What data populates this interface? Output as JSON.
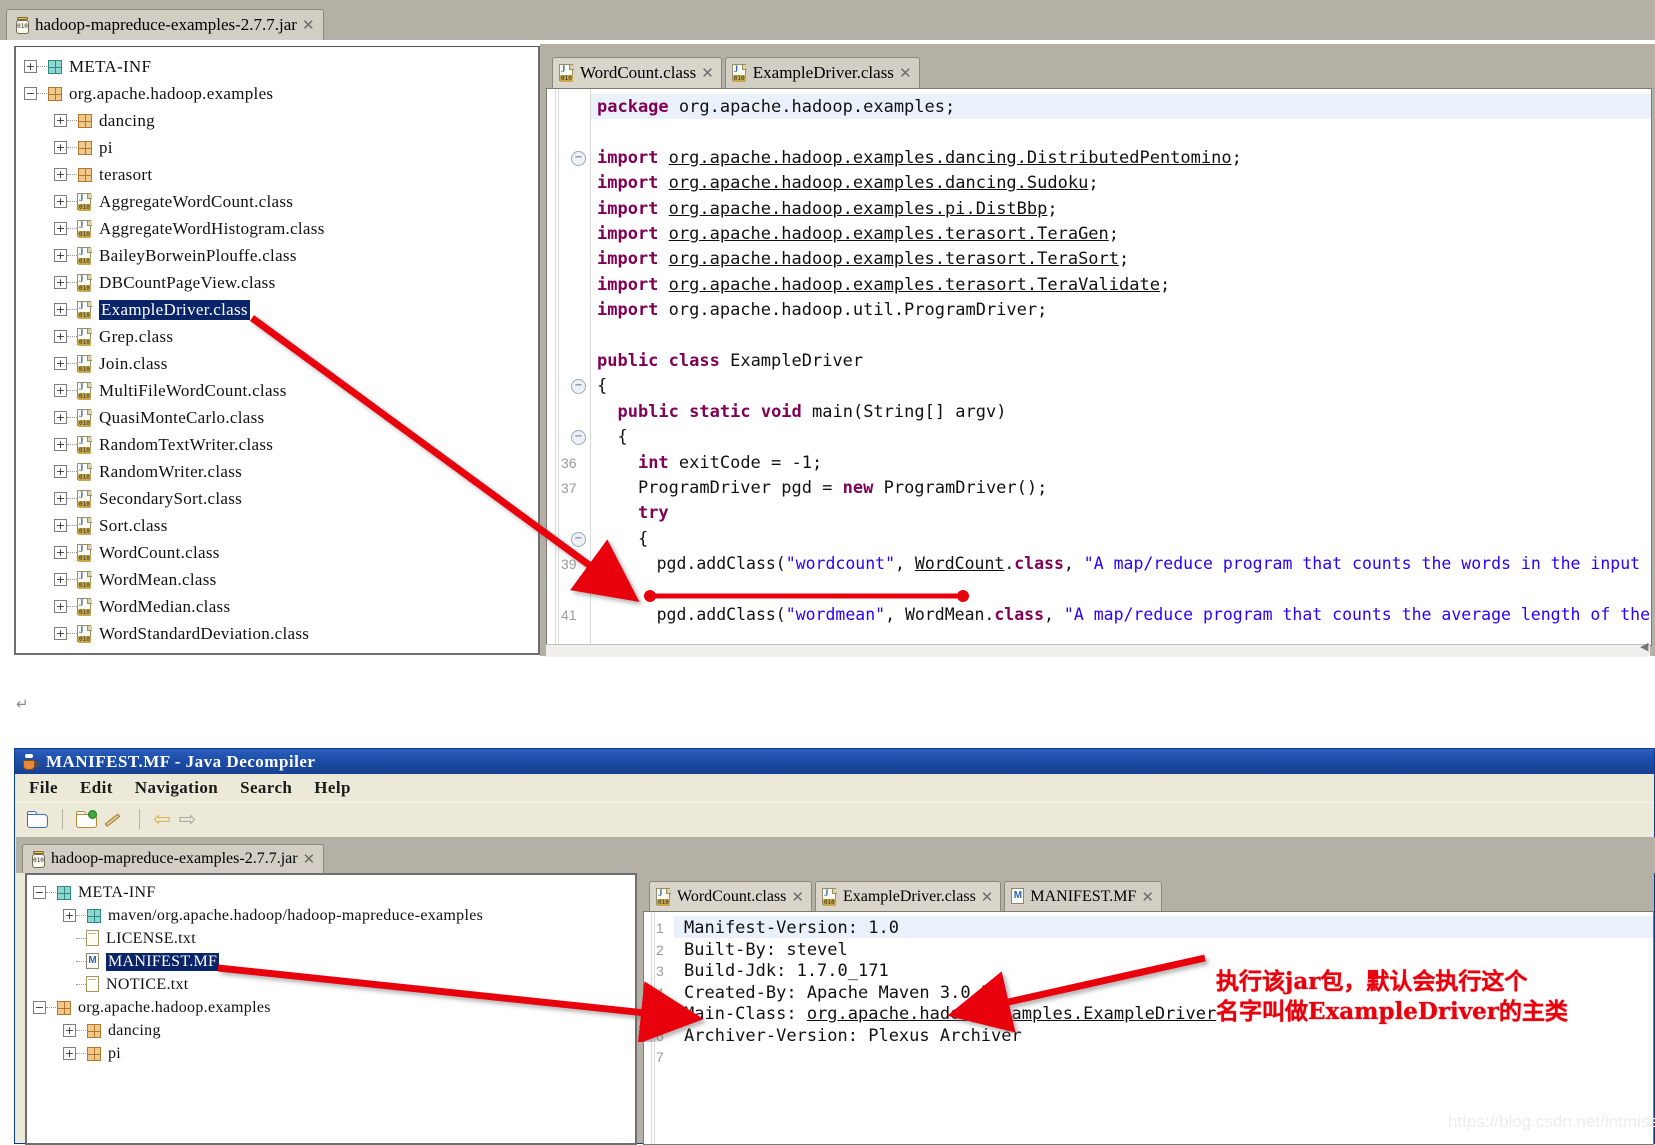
{
  "top_window": {
    "jar_tab": {
      "label": "hadoop-mapreduce-examples-2.7.7.jar",
      "close": "✕",
      "icon": "jar-icon"
    },
    "tree": [
      {
        "indent": 0,
        "toggle": "+",
        "icon": "package-icon-teal",
        "label": "META-INF",
        "selected": false
      },
      {
        "indent": 0,
        "toggle": "−",
        "icon": "package-icon",
        "label": "org.apache.hadoop.examples",
        "selected": false
      },
      {
        "indent": 1,
        "toggle": "+",
        "icon": "package-icon",
        "label": "dancing",
        "selected": false
      },
      {
        "indent": 1,
        "toggle": "+",
        "icon": "package-icon",
        "label": "pi",
        "selected": false
      },
      {
        "indent": 1,
        "toggle": "+",
        "icon": "package-icon",
        "label": "terasort",
        "selected": false
      },
      {
        "indent": 1,
        "toggle": "+",
        "icon": "class-icon",
        "label": "AggregateWordCount.class",
        "selected": false
      },
      {
        "indent": 1,
        "toggle": "+",
        "icon": "class-icon",
        "label": "AggregateWordHistogram.class",
        "selected": false
      },
      {
        "indent": 1,
        "toggle": "+",
        "icon": "class-icon",
        "label": "BaileyBorweinPlouffe.class",
        "selected": false
      },
      {
        "indent": 1,
        "toggle": "+",
        "icon": "class-icon",
        "label": "DBCountPageView.class",
        "selected": false
      },
      {
        "indent": 1,
        "toggle": "+",
        "icon": "class-icon",
        "label": "ExampleDriver.class",
        "selected": true
      },
      {
        "indent": 1,
        "toggle": "+",
        "icon": "class-icon",
        "label": "Grep.class",
        "selected": false
      },
      {
        "indent": 1,
        "toggle": "+",
        "icon": "class-icon",
        "label": "Join.class",
        "selected": false
      },
      {
        "indent": 1,
        "toggle": "+",
        "icon": "class-icon",
        "label": "MultiFileWordCount.class",
        "selected": false
      },
      {
        "indent": 1,
        "toggle": "+",
        "icon": "class-icon",
        "label": "QuasiMonteCarlo.class",
        "selected": false
      },
      {
        "indent": 1,
        "toggle": "+",
        "icon": "class-icon",
        "label": "RandomTextWriter.class",
        "selected": false
      },
      {
        "indent": 1,
        "toggle": "+",
        "icon": "class-icon",
        "label": "RandomWriter.class",
        "selected": false
      },
      {
        "indent": 1,
        "toggle": "+",
        "icon": "class-icon",
        "label": "SecondarySort.class",
        "selected": false
      },
      {
        "indent": 1,
        "toggle": "+",
        "icon": "class-icon",
        "label": "Sort.class",
        "selected": false
      },
      {
        "indent": 1,
        "toggle": "+",
        "icon": "class-icon",
        "label": "WordCount.class",
        "selected": false
      },
      {
        "indent": 1,
        "toggle": "+",
        "icon": "class-icon",
        "label": "WordMean.class",
        "selected": false
      },
      {
        "indent": 1,
        "toggle": "+",
        "icon": "class-icon",
        "label": "WordMedian.class",
        "selected": false
      },
      {
        "indent": 1,
        "toggle": "+",
        "icon": "class-icon",
        "label": "WordStandardDeviation.class",
        "selected": false
      }
    ],
    "editor_tabs": [
      {
        "label": "WordCount.class",
        "icon": "class-icon",
        "close": "✕",
        "active": false
      },
      {
        "label": "ExampleDriver.class",
        "icon": "class-icon",
        "close": "✕",
        "active": true
      }
    ],
    "code_lines": [
      {
        "num": "",
        "fold": "",
        "text": "package org.apache.hadoop.examples;",
        "highlight": true
      },
      {
        "num": "",
        "fold": "",
        "text": ""
      },
      {
        "num": "",
        "fold": "−",
        "text": "import org.apache.hadoop.examples.dancing.DistributedPentomino;"
      },
      {
        "num": "",
        "fold": "",
        "text": "import org.apache.hadoop.examples.dancing.Sudoku;"
      },
      {
        "num": "",
        "fold": "",
        "text": "import org.apache.hadoop.examples.pi.DistBbp;"
      },
      {
        "num": "",
        "fold": "",
        "text": "import org.apache.hadoop.examples.terasort.TeraGen;"
      },
      {
        "num": "",
        "fold": "",
        "text": "import org.apache.hadoop.examples.terasort.TeraSort;"
      },
      {
        "num": "",
        "fold": "",
        "text": "import org.apache.hadoop.examples.terasort.TeraValidate;"
      },
      {
        "num": "",
        "fold": "",
        "text": "import org.apache.hadoop.util.ProgramDriver;"
      },
      {
        "num": "",
        "fold": "",
        "text": ""
      },
      {
        "num": "",
        "fold": "",
        "text": "public class ExampleDriver"
      },
      {
        "num": "",
        "fold": "−",
        "text": "{"
      },
      {
        "num": "",
        "fold": "",
        "text": "  public static void main(String[] argv)"
      },
      {
        "num": "",
        "fold": "−",
        "text": "  {"
      },
      {
        "num": "36",
        "fold": "",
        "text": "    int exitCode = -1;"
      },
      {
        "num": "37",
        "fold": "",
        "text": "    ProgramDriver pgd = new ProgramDriver();"
      },
      {
        "num": "",
        "fold": "",
        "text": "    try"
      },
      {
        "num": "",
        "fold": "−",
        "text": "    {"
      },
      {
        "num": "39",
        "fold": "",
        "text": "      pgd.addClass(\"wordcount\", WordCount.class, \"A map/reduce program that counts the words in the input files.\");"
      },
      {
        "num": "",
        "fold": "",
        "text": ""
      },
      {
        "num": "41",
        "fold": "",
        "text": "      pgd.addClass(\"wordmean\", WordMean.class, \"A map/reduce program that counts the average length of the words in"
      }
    ]
  },
  "bottom_window": {
    "title": "MANIFEST.MF - Java Decompiler",
    "title_icon": "java-cup-icon",
    "menus": [
      "File",
      "Edit",
      "Navigation",
      "Search",
      "Help"
    ],
    "toolbar_icons": [
      "open-folder-icon",
      "open-jar-icon",
      "wand-icon",
      "back-arrow-icon",
      "forward-arrow-icon"
    ],
    "jar_tab": {
      "label": "hadoop-mapreduce-examples-2.7.7.jar",
      "close": "✕",
      "icon": "jar-icon"
    },
    "tree": [
      {
        "indent": 0,
        "toggle": "−",
        "icon": "package-icon-teal",
        "label": "META-INF",
        "selected": false
      },
      {
        "indent": 1,
        "toggle": "+",
        "icon": "package-icon-teal",
        "label": "maven/org.apache.hadoop/hadoop-mapreduce-examples",
        "selected": false
      },
      {
        "indent": 1,
        "toggle": "",
        "icon": "text-file-icon",
        "label": "LICENSE.txt",
        "selected": false
      },
      {
        "indent": 1,
        "toggle": "",
        "icon": "manifest-icon",
        "label": "MANIFEST.MF",
        "selected": true
      },
      {
        "indent": 1,
        "toggle": "",
        "icon": "text-file-icon",
        "label": "NOTICE.txt",
        "selected": false
      },
      {
        "indent": 0,
        "toggle": "−",
        "icon": "package-icon",
        "label": "org.apache.hadoop.examples",
        "selected": false
      },
      {
        "indent": 1,
        "toggle": "+",
        "icon": "package-icon",
        "label": "dancing",
        "selected": false
      },
      {
        "indent": 1,
        "toggle": "+",
        "icon": "package-icon",
        "label": "pi",
        "selected": false
      }
    ],
    "editor_tabs": [
      {
        "label": "WordCount.class",
        "icon": "class-icon",
        "close": "✕",
        "active": false
      },
      {
        "label": "ExampleDriver.class",
        "icon": "class-icon",
        "close": "✕",
        "active": false
      },
      {
        "label": "MANIFEST.MF",
        "icon": "manifest-icon",
        "close": "✕",
        "active": true
      }
    ],
    "manifest_lines": [
      {
        "num": "1",
        "text": "Manifest-Version: 1.0",
        "highlight": true
      },
      {
        "num": "2",
        "text": "Built-By: stevel"
      },
      {
        "num": "3",
        "text": "Build-Jdk: 1.7.0_171"
      },
      {
        "num": "4",
        "text": "Created-By: Apache Maven 3.0.5"
      },
      {
        "num": "5",
        "text": "Main-Class: org.apache.hadoop.examples.ExampleDriver",
        "link_from": 12
      },
      {
        "num": "6",
        "text": "Archiver-Version: Plexus Archiver"
      },
      {
        "num": "7",
        "text": ""
      }
    ]
  },
  "annotations": {
    "note_line1": "执行该jar包，默认会执行这个",
    "note_line2": "名字叫做ExampleDriver的主类",
    "arrow_color": "#e8000d",
    "return_mark": "↵"
  },
  "watermark": "https://blog.csdn.net/intmiss"
}
